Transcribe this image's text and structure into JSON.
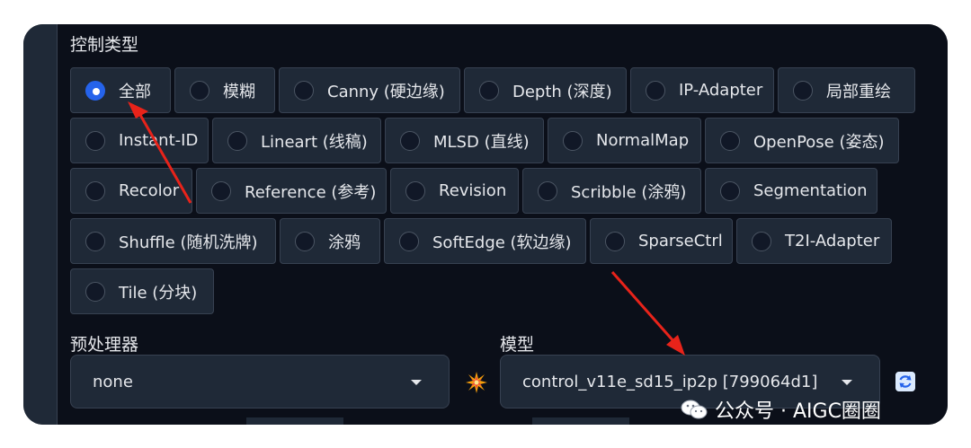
{
  "control_type": {
    "label": "控制类型",
    "options": [
      {
        "label": "全部",
        "selected": true
      },
      {
        "label": "模糊"
      },
      {
        "label": "Canny (硬边缘)"
      },
      {
        "label": "Depth (深度)"
      },
      {
        "label": "IP-Adapter"
      },
      {
        "label": "局部重绘"
      },
      {
        "label": "Instant-ID"
      },
      {
        "label": "Lineart (线稿)"
      },
      {
        "label": "MLSD (直线)"
      },
      {
        "label": "NormalMap"
      },
      {
        "label": "OpenPose (姿态)"
      },
      {
        "label": "Recolor"
      },
      {
        "label": "Reference (参考)"
      },
      {
        "label": "Revision"
      },
      {
        "label": "Scribble (涂鸦)"
      },
      {
        "label": "Segmentation"
      },
      {
        "label": "Shuffle (随机洗牌)"
      },
      {
        "label": "涂鸦"
      },
      {
        "label": "SoftEdge (软边缘)"
      },
      {
        "label": "SparseCtrl"
      },
      {
        "label": "T2I-Adapter"
      },
      {
        "label": "Tile (分块)"
      }
    ]
  },
  "preprocessor": {
    "label": "预处理器",
    "value": "none"
  },
  "model": {
    "label": "模型",
    "value": "control_v11e_sd15_ip2p [799064d1]"
  },
  "icons": {
    "run_preprocessor": "explosion-icon",
    "refresh_models": "refresh-icon",
    "watermark": "wechat-icon"
  },
  "watermark": {
    "text": "公众号 · AIGC圈圈"
  },
  "colors": {
    "background": "#0b0f19",
    "control": "#1f2937",
    "border": "#374151",
    "text": "#e5e7eb",
    "selected": "#2563eb",
    "annotation_arrow": "#e8231a"
  }
}
